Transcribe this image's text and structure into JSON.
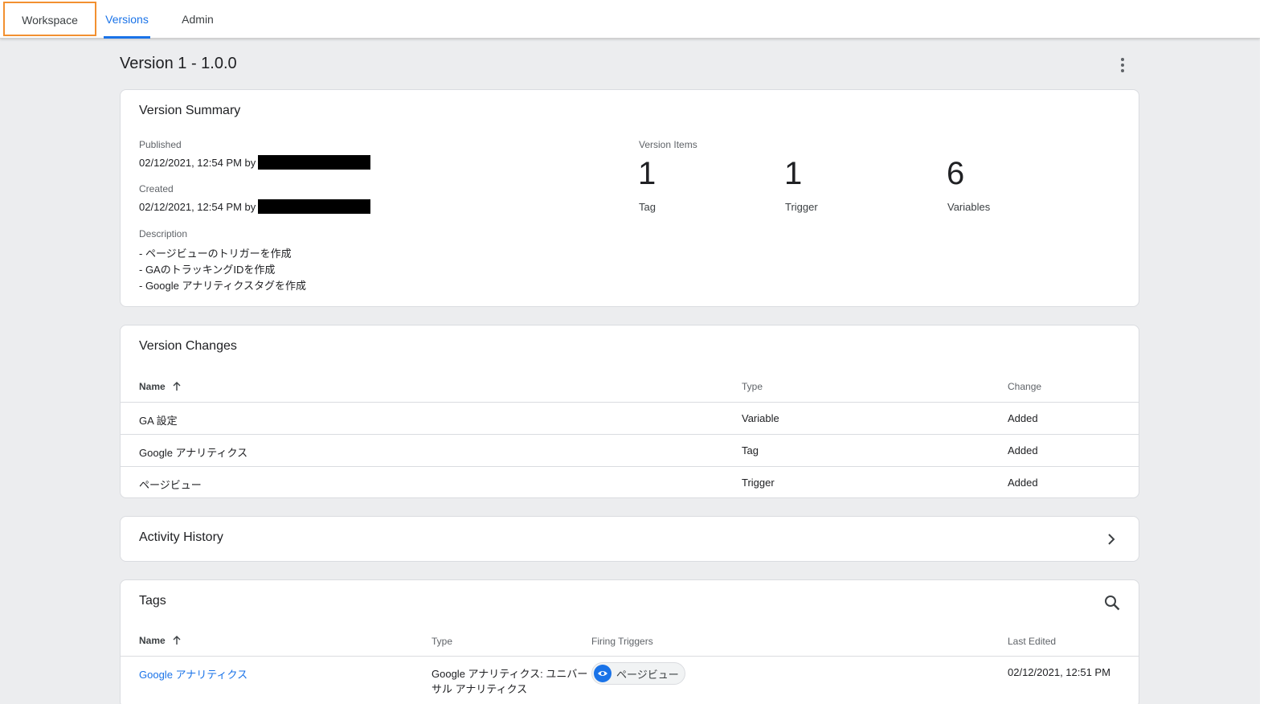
{
  "tabs": {
    "workspace": "Workspace",
    "versions": "Versions",
    "admin": "Admin"
  },
  "page": {
    "title": "Version 1 - 1.0.0"
  },
  "summary": {
    "title": "Version Summary",
    "published_label": "Published",
    "published_value": "02/12/2021, 12:54 PM by",
    "created_label": "Created",
    "created_value": "02/12/2021, 12:54 PM by",
    "description_label": "Description",
    "description_lines": [
      "- ページビューのトリガーを作成",
      "- GAのトラッキングIDを作成",
      "- Google アナリティクスタグを作成"
    ],
    "items_label": "Version Items",
    "items": [
      {
        "count": "1",
        "label": "Tag"
      },
      {
        "count": "1",
        "label": "Trigger"
      },
      {
        "count": "6",
        "label": "Variables"
      }
    ]
  },
  "changes": {
    "title": "Version Changes",
    "columns": {
      "name": "Name",
      "type": "Type",
      "change": "Change"
    },
    "rows": [
      {
        "name": "GA 設定",
        "type": "Variable",
        "change": "Added"
      },
      {
        "name": "Google アナリティクス",
        "type": "Tag",
        "change": "Added"
      },
      {
        "name": "ページビュー",
        "type": "Trigger",
        "change": "Added"
      }
    ]
  },
  "activity": {
    "title": "Activity History"
  },
  "tags": {
    "title": "Tags",
    "columns": {
      "name": "Name",
      "type": "Type",
      "firing": "Firing Triggers",
      "edited": "Last Edited"
    },
    "rows": [
      {
        "name": "Google アナリティクス",
        "type": "Google アナリティクス: ユニバーサル アナリティクス",
        "trigger": "ページビュー",
        "edited": "02/12/2021, 12:51 PM"
      }
    ]
  },
  "icons": {
    "more": "more-vert-icon",
    "chevron": "chevron-right-icon",
    "search": "search-icon",
    "sort": "arrow-up-icon",
    "eye": "eye-icon"
  },
  "colors": {
    "accent": "#1a73e8",
    "highlight": "#f29030"
  }
}
